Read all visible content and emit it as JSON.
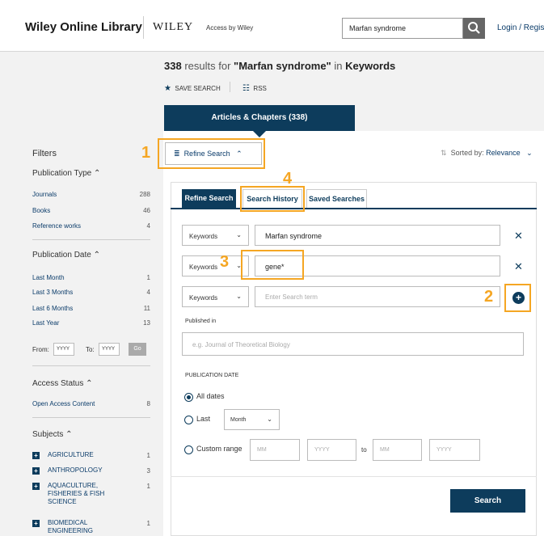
{
  "header": {
    "site_name": "Wiley Online Library",
    "brand": "WILEY",
    "access_by": "Access by Wiley",
    "search_value": "Marfan syndrome",
    "login": "Login / Registe"
  },
  "results": {
    "count": "338",
    "results_for": "results for",
    "query": "\"Marfan syndrome\"",
    "in": "in",
    "field": "Keywords",
    "save_search": "SAVE SEARCH",
    "rss": "RSS",
    "articles_tab": "Articles & Chapters (338)"
  },
  "filters": {
    "title": "Filters",
    "publication_type": {
      "heading": "Publication Type",
      "items": [
        {
          "label": "Journals",
          "count": "288"
        },
        {
          "label": "Books",
          "count": "46"
        },
        {
          "label": "Reference works",
          "count": "4"
        }
      ]
    },
    "publication_date": {
      "heading": "Publication Date",
      "items": [
        {
          "label": "Last Month",
          "count": "1"
        },
        {
          "label": "Last 3 Months",
          "count": "4"
        },
        {
          "label": "Last 6 Months",
          "count": "11"
        },
        {
          "label": "Last Year",
          "count": "13"
        }
      ],
      "from_label": "From:",
      "to_label": "To:",
      "from_placeholder": "YYYY",
      "to_placeholder": "YYYY",
      "go": "Go"
    },
    "access_status": {
      "heading": "Access Status",
      "items": [
        {
          "label": "Open Access Content",
          "count": "8"
        }
      ]
    },
    "subjects": {
      "heading": "Subjects",
      "items": [
        {
          "label": "AGRICULTURE",
          "count": "1"
        },
        {
          "label": "ANTHROPOLOGY",
          "count": "3"
        },
        {
          "label": "AQUACULTURE, FISHERIES & FISH SCIENCE",
          "count": "1"
        },
        {
          "label": "BIOMEDICAL ENGINEERING",
          "count": "1"
        }
      ]
    }
  },
  "main": {
    "refine_toggle": "Refine Search",
    "sorted_by_label": "Sorted by:",
    "sorted_by_value": "Relevance",
    "tabs": [
      "Refine Search",
      "Search History",
      "Saved Searches"
    ],
    "rows": [
      {
        "field": "Keywords",
        "term": "Marfan syndrome"
      },
      {
        "field": "Keywords",
        "term": "gene*"
      },
      {
        "field": "Keywords",
        "placeholder": "Enter Search term"
      }
    ],
    "published_in_label": "Published in",
    "published_in_placeholder": "e.g. Journal of Theoretical Biology",
    "publication_date_label": "PUBLICATION DATE",
    "all_dates": "All dates",
    "last": "Last",
    "month_option": "Month",
    "custom_range": "Custom range",
    "mm": "MM",
    "yyyy": "YYYY",
    "to": "to",
    "search_button": "Search"
  },
  "annotations": [
    "1",
    "2",
    "3",
    "4"
  ],
  "colors": {
    "accent": "#0d3c5c",
    "annotation": "#f5a623",
    "link": "#0b3c6a"
  }
}
